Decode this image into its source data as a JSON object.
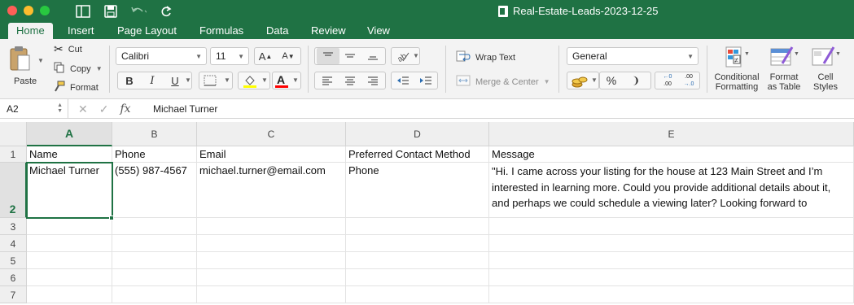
{
  "window": {
    "title": "Real-Estate-Leads-2023-12-25"
  },
  "tabs": [
    {
      "label": "Home"
    },
    {
      "label": "Insert"
    },
    {
      "label": "Page Layout"
    },
    {
      "label": "Formulas"
    },
    {
      "label": "Data"
    },
    {
      "label": "Review"
    },
    {
      "label": "View"
    }
  ],
  "clipboard": {
    "paste": "Paste",
    "cut": "Cut",
    "copy": "Copy",
    "format": "Format"
  },
  "font": {
    "name": "Calibri",
    "size": "11",
    "bold": "B",
    "italic": "I",
    "underline": "U",
    "grow": "A",
    "shrink": "A"
  },
  "alignment": {
    "wrap_text": "Wrap Text",
    "merge_center": "Merge & Center"
  },
  "number": {
    "format": "General",
    "percent": "%",
    "comma": "❩",
    "inc_decimal_top": "←0",
    "inc_decimal_bottom": ".00",
    "dec_decimal_top": ".00",
    "dec_decimal_bottom": "→.0"
  },
  "styles": {
    "conditional_line1": "Conditional",
    "conditional_line2": "Formatting",
    "format_table_line1": "Format",
    "format_table_line2": "as Table",
    "cell_styles_line1": "Cell",
    "cell_styles_line2": "Styles"
  },
  "formula_bar": {
    "cell_ref": "A2",
    "fx": "fx",
    "value": "Michael Turner"
  },
  "columns": [
    "A",
    "B",
    "C",
    "D",
    "E"
  ],
  "rows": [
    "1",
    "2",
    "3",
    "4",
    "5",
    "6",
    "7"
  ],
  "sheet": {
    "header": {
      "name": "Name",
      "phone": "Phone",
      "email": "Email",
      "method": "Preferred Contact Method",
      "message": "Message"
    },
    "row2": {
      "name": "Michael Turner",
      "phone": "(555) 987-4567",
      "email": "michael.turner@email.com",
      "method": "Phone",
      "message": "\"Hi. I came across your listing for the house at 123 Main Street and I’m interested in learning more. Could you provide additional details about it, and perhaps we could schedule a viewing later? Looking forward to"
    }
  },
  "colors": {
    "accent": "#1f7244",
    "highlight": "#ffff00",
    "font_color": "#ff0000"
  }
}
